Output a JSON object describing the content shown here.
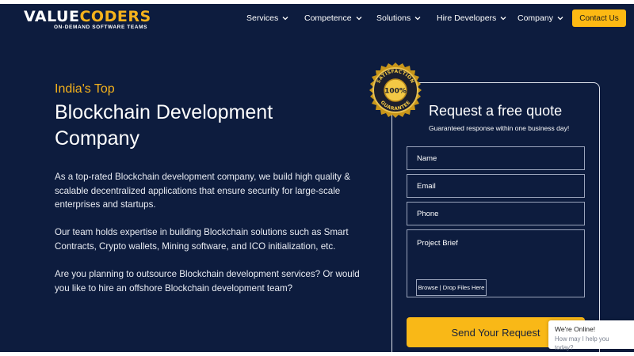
{
  "brand": {
    "logo_part1": "VALUE",
    "logo_part2": "CODERS",
    "tagline": "ON-DEMAND SOFTWARE TEAMS"
  },
  "nav": {
    "items": [
      {
        "label": "Services"
      },
      {
        "label": "Competence"
      },
      {
        "label": "Solutions"
      },
      {
        "label": "Hire Developers"
      },
      {
        "label": "Company"
      }
    ],
    "cta_label": "Contact Us"
  },
  "hero": {
    "eyebrow": "India's Top",
    "title_line1": "Blockchain Development",
    "title_line2": "Company",
    "paragraphs": [
      "As a top-rated Blockchain development company, we build high quality & scalable decentralized applications that ensure security for large-scale enterprises and startups.",
      "Our team holds expertise in building Blockchain solutions such as Smart Contracts, Crypto wallets, Mining software, and ICO initialization, etc.",
      "Are you planning to outsource Blockchain development services? Or would you like to hire an offshore Blockchain development team?"
    ]
  },
  "badge": {
    "top_text": "SATISFACTION",
    "center_text": "100%",
    "bottom_text": "GUARANTEE"
  },
  "form": {
    "title": "Request a free quote",
    "subtitle": "Guaranteed response within one business day!",
    "fields": [
      {
        "placeholder": "Name"
      },
      {
        "placeholder": "Email"
      },
      {
        "placeholder": "Phone"
      },
      {
        "placeholder": "Project Brief"
      }
    ],
    "file_button": "Browse | Drop Files Here",
    "submit_label": "Send Your Request"
  },
  "chat": {
    "title": "We're Online!",
    "subtitle": "How may I help you today?"
  },
  "colors": {
    "background": "#0d1c3e",
    "accent": "#f9b817",
    "text": "#ffffff"
  }
}
